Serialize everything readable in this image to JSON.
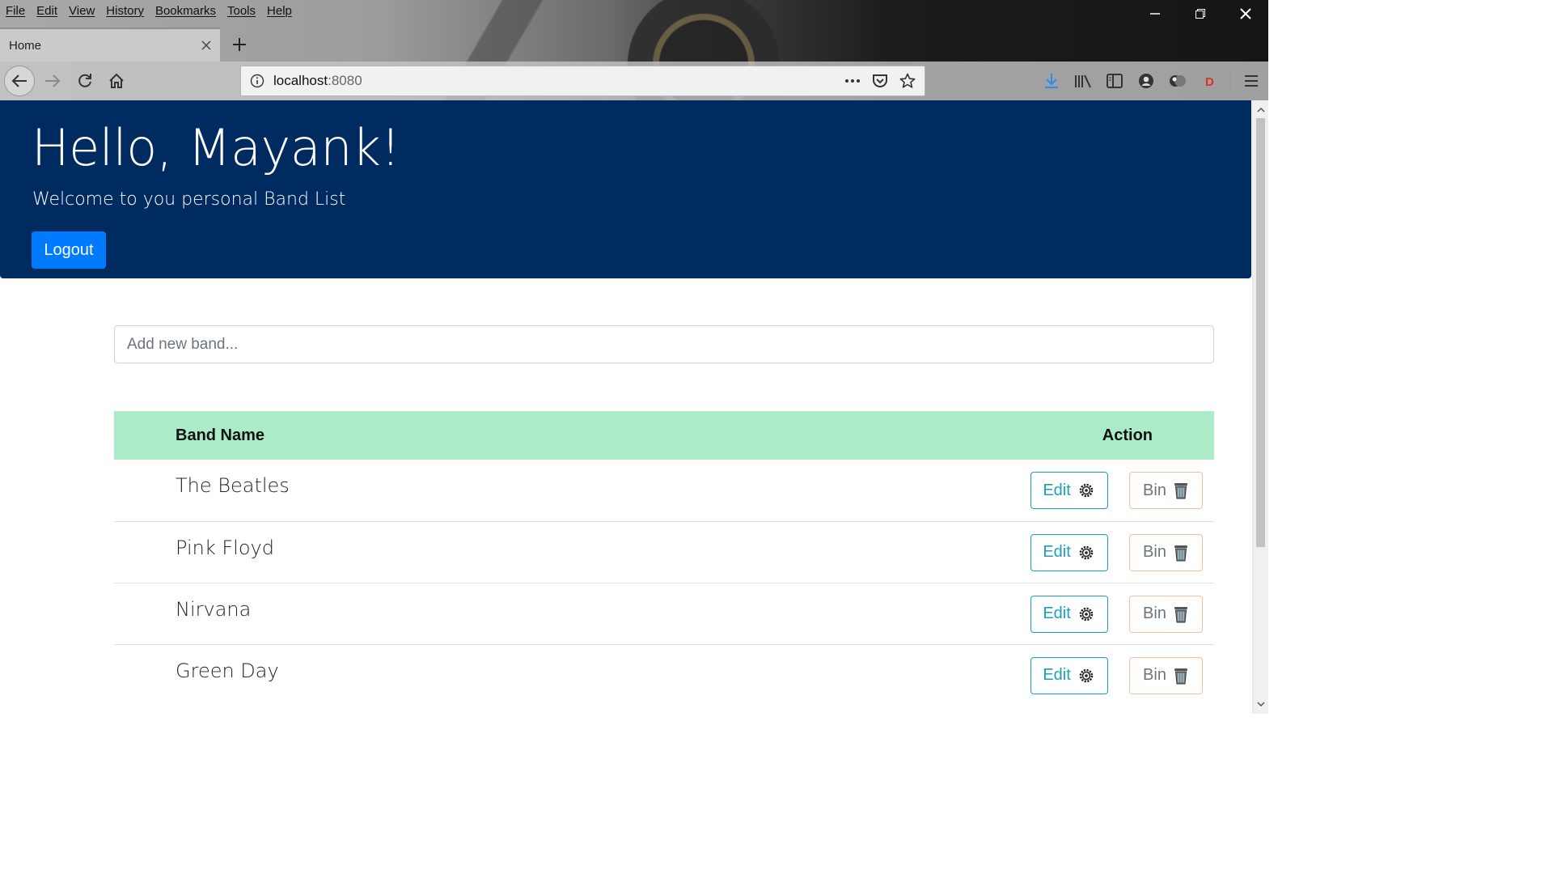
{
  "browser": {
    "menu": [
      "File",
      "Edit",
      "View",
      "History",
      "Bookmarks",
      "Tools",
      "Help"
    ],
    "tab": {
      "title": "Home"
    },
    "url": {
      "host": "localhost",
      "port": ":8080"
    },
    "window_controls": [
      "minimize-icon",
      "restore-icon",
      "close-icon"
    ],
    "nav_icons": [
      "back-arrow-icon",
      "forward-arrow-icon",
      "reload-icon",
      "home-icon"
    ],
    "url_actions": [
      "more-icon",
      "pocket-icon",
      "bookmark-star-icon"
    ],
    "toolbar_icons": [
      "download-icon",
      "library-icon",
      "sidebar-icon",
      "account-icon",
      "extension-icon",
      "extension-d-icon",
      "hamburger-menu-icon"
    ],
    "accent": "#2a8cf0"
  },
  "page": {
    "heading": "Hello, Mayank!",
    "subheading": "Welcome to you personal Band List",
    "logout_label": "Logout",
    "add_placeholder": "Add new band...",
    "table": {
      "headers": {
        "name": "Band Name",
        "action": "Action"
      },
      "rows": [
        {
          "name": "The Beatles"
        },
        {
          "name": "Pink Floyd"
        },
        {
          "name": "Nirvana"
        },
        {
          "name": "Green Day"
        }
      ],
      "edit_label": "Edit",
      "bin_label": "Bin"
    },
    "colors": {
      "jumbotron": "#002b61",
      "primary": "#007bff",
      "header_row": "#acebc7",
      "edit": "#17a2b8",
      "bin_border": "#f6c19a"
    }
  }
}
